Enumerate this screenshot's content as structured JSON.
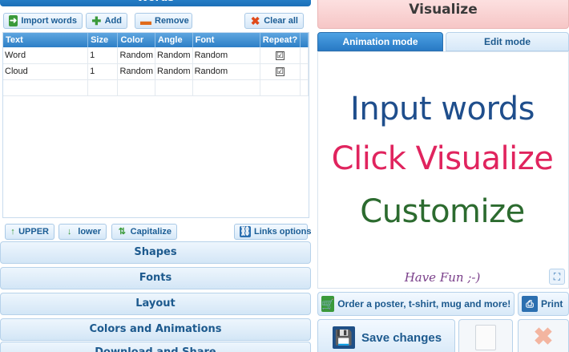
{
  "words_panel": {
    "title": "Words",
    "toolbar": {
      "import_label": "Import words",
      "add_label": "Add",
      "remove_label": "Remove",
      "clear_label": "Clear all"
    },
    "table": {
      "headers": [
        "Text",
        "Size",
        "Color",
        "Angle",
        "Font",
        "Repeat?"
      ],
      "rows": [
        {
          "text": "Word",
          "size": "1",
          "color": "Random",
          "angle": "Random",
          "font": "Random",
          "repeat": "☑"
        },
        {
          "text": "Cloud",
          "size": "1",
          "color": "Random",
          "angle": "Random",
          "font": "Random",
          "repeat": "☑"
        }
      ]
    },
    "case_tools": {
      "upper_label": "UPPER",
      "lower_label": "lower",
      "capitalize_label": "Capitalize",
      "links_label": "Links options"
    }
  },
  "sections": {
    "shapes": "Shapes",
    "fonts": "Fonts",
    "layout": "Layout",
    "colors": "Colors and Animations",
    "download": "Download and Share"
  },
  "right_panel": {
    "visualize_label": "Visualize",
    "tabs": {
      "animation": "Animation mode",
      "edit": "Edit mode"
    },
    "canvas_words": {
      "line1": "Input words",
      "line2": "Click Visualize",
      "line3": "Customize",
      "line4": "Have Fun ;-)"
    },
    "order_label": "Order a poster, t-shirt, mug and more!",
    "print_label": "Print",
    "save_label": "Save changes"
  },
  "colors": {
    "accent_blue": "#2879c4",
    "visualize_pink": "#f6c6c6",
    "word_blue": "#1f4e8c",
    "word_pink": "#e0245e",
    "word_green": "#2c6b2f",
    "word_purple": "#7a3f8a"
  }
}
